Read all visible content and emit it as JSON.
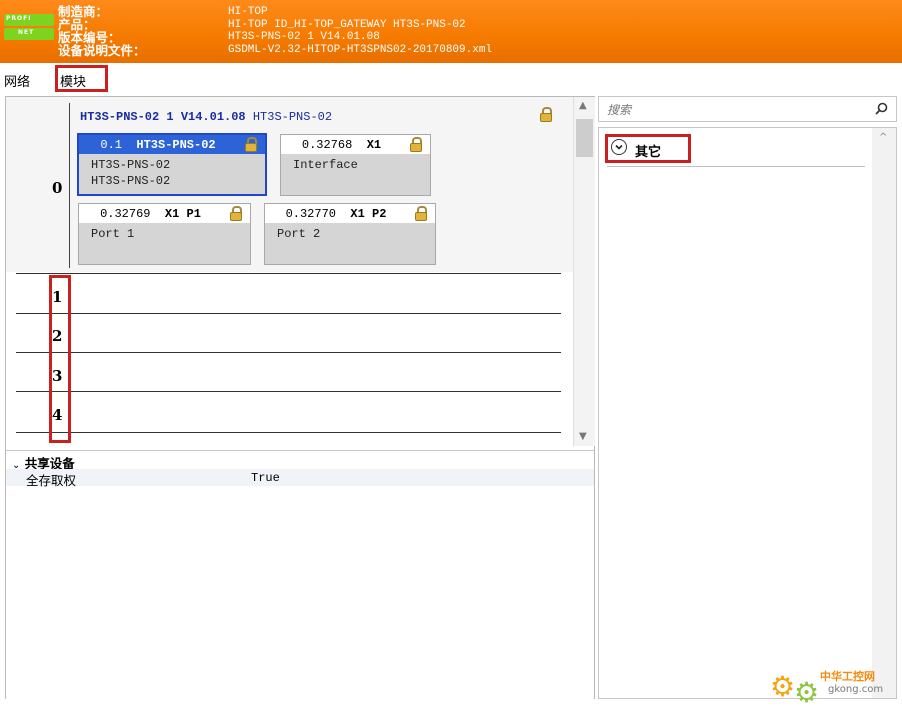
{
  "header": {
    "logo_top": "PROFI",
    "logo_bottom": "NET",
    "fields": [
      {
        "label": "制造商：",
        "value": "HI-TOP"
      },
      {
        "label": "产品：",
        "value": "HI-TOP ID_HI-TOP_GATEWAY HT3S-PNS-02"
      },
      {
        "label": "版本编号：",
        "value": "HT3S-PNS-02 1 V14.01.08"
      },
      {
        "label": "设备说明文件：",
        "value": "GSDML-V2.32-HITOP-HT3SPNS02-20170809.xml"
      }
    ]
  },
  "tabs": [
    "网络",
    "模块"
  ],
  "rack": {
    "device_title_bold": "HT3S-PNS-02 1 V14.01.08",
    "device_title_rest": "HT3S-PNS-02",
    "slot0_label": "0",
    "modules": [
      {
        "addr": "0.1",
        "name": "HT3S-PNS-02",
        "lines": [
          "HT3S-PNS-02",
          "HT3S-PNS-02"
        ],
        "selected": true
      },
      {
        "addr": "0.32768",
        "name": "X1",
        "lines": [
          "Interface"
        ],
        "selected": false
      },
      {
        "addr": "0.32769",
        "name": "X1 P1",
        "lines": [
          "Port 1"
        ],
        "selected": false
      },
      {
        "addr": "0.32770",
        "name": "X1 P2",
        "lines": [
          "Port 2"
        ],
        "selected": false
      }
    ],
    "slots": [
      "1",
      "2",
      "3",
      "4"
    ]
  },
  "properties": {
    "group": "共享设备",
    "rows": [
      {
        "key": "全存取权",
        "value": "True"
      }
    ]
  },
  "catalog": {
    "search_placeholder": "搜索",
    "items": [
      "其它"
    ]
  },
  "watermark": {
    "line1": "中华工控网",
    "line2": "gkong.com"
  },
  "colors": {
    "header": "#f57a00",
    "selected_module": "#2c63d6",
    "highlight_box": "#cc1f1f",
    "title_blue": "#1a2ea0"
  }
}
